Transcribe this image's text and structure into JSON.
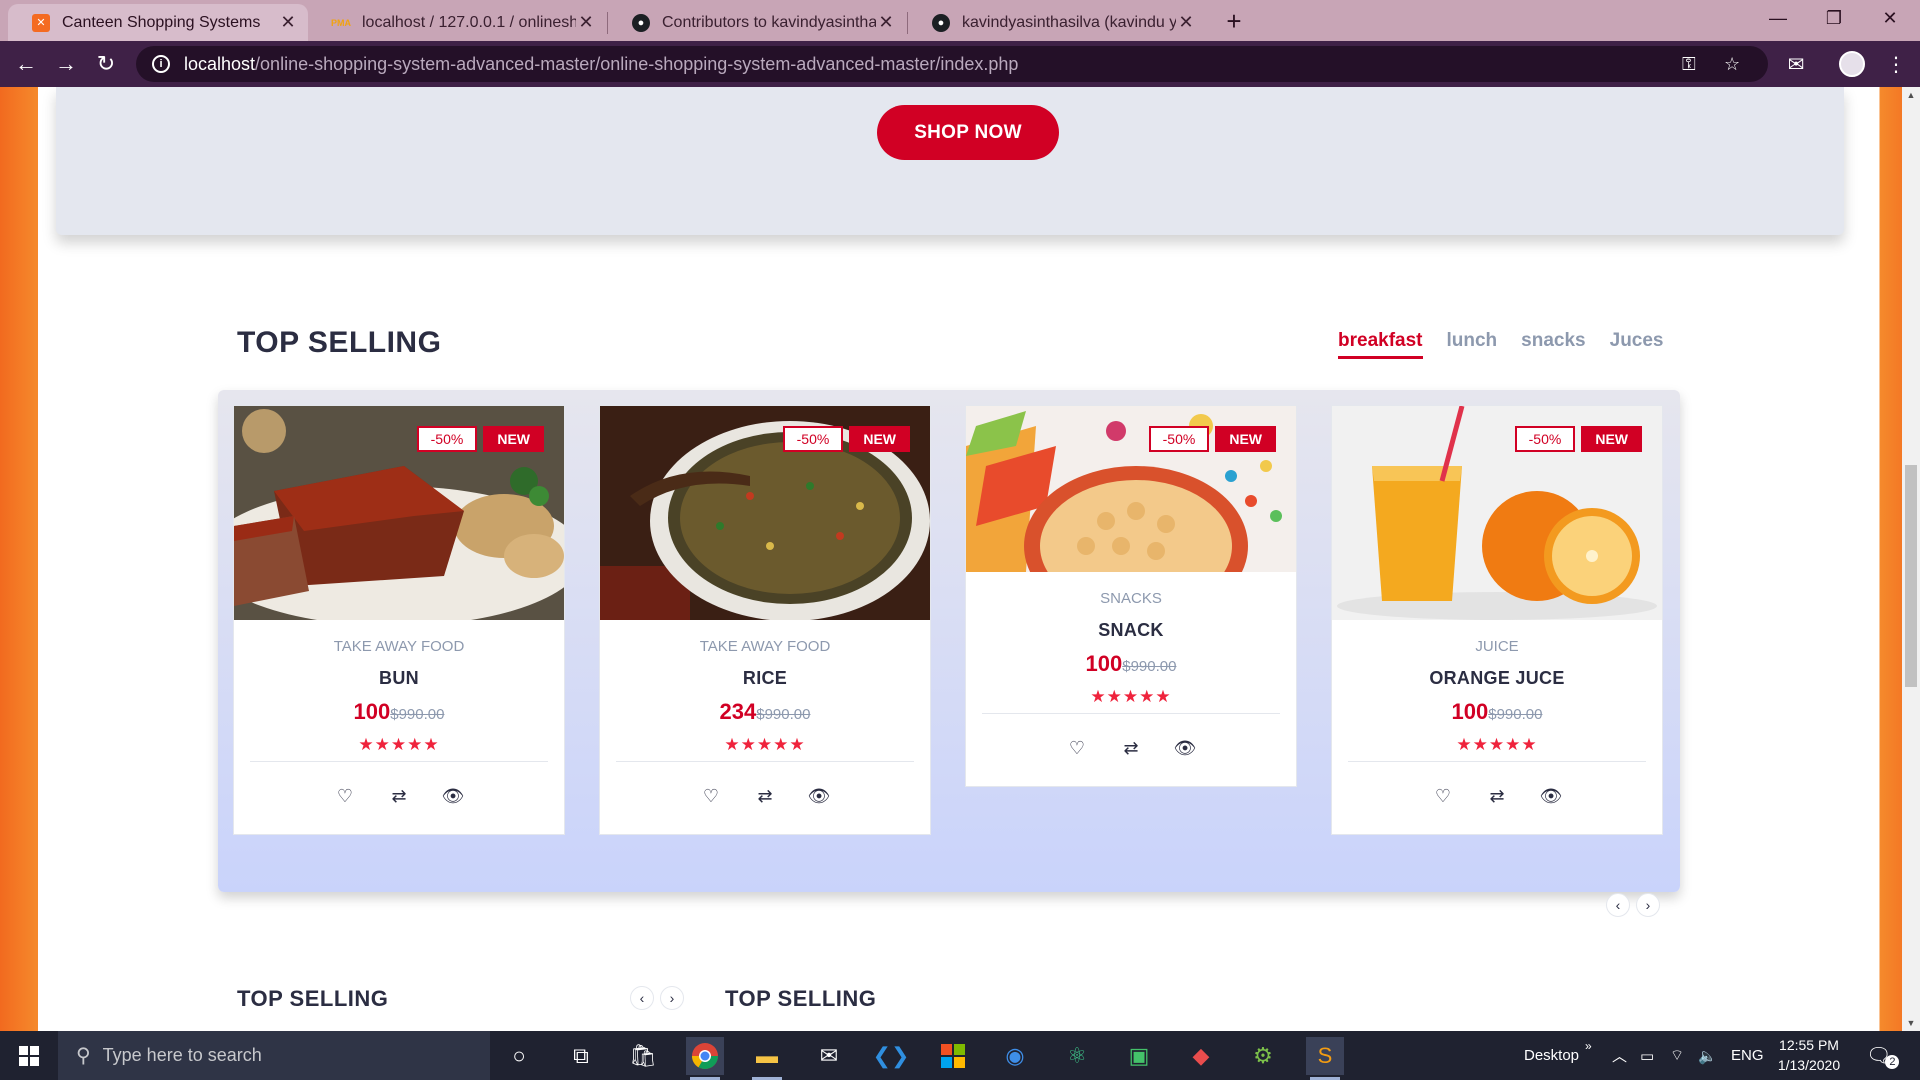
{
  "browser": {
    "tabs": [
      {
        "title": "Canteen Shopping Systems",
        "active": true
      },
      {
        "title": "localhost / 127.0.0.1 / onlineshop",
        "active": false
      },
      {
        "title": "Contributors to kavindyasinthasilva",
        "active": false
      },
      {
        "title": "kavindyasinthasilva (kavindu yasi",
        "active": false
      }
    ],
    "url_host": "localhost",
    "url_path": "/online-shopping-system-advanced-master/online-shopping-system-advanced-master/index.php"
  },
  "hero": {
    "shop_now": "SHOP NOW"
  },
  "section": {
    "title": "TOP SELLING",
    "tabs": [
      "breakfast",
      "lunch",
      "snacks",
      "Juces"
    ]
  },
  "products": [
    {
      "category": "TAKE AWAY FOOD",
      "name": "BUN",
      "price": "100",
      "old_price": "$990.00",
      "sale": "-50%",
      "new": "NEW",
      "rating": 5
    },
    {
      "category": "TAKE AWAY FOOD",
      "name": "RICE",
      "price": "234",
      "old_price": "$990.00",
      "sale": "-50%",
      "new": "NEW",
      "rating": 5
    },
    {
      "category": "SNACKS",
      "name": "SNACK",
      "price": "100",
      "old_price": "$990.00",
      "sale": "-50%",
      "new": "NEW",
      "rating": 5
    },
    {
      "category": "JUICE",
      "name": "ORANGE JUCE",
      "price": "100",
      "old_price": "$990.00",
      "sale": "-50%",
      "new": "NEW",
      "rating": 5
    }
  ],
  "bottom": {
    "title_left": "TOP SELLING",
    "title_right": "TOP SELLING"
  },
  "taskbar": {
    "search_placeholder": "Type here to search",
    "desktop_label": "Desktop",
    "lang": "ENG",
    "time": "12:55 PM",
    "date": "1/13/2020",
    "notifications": "2"
  },
  "colors": {
    "accent": "#d10024",
    "dark": "#2b2d42",
    "muted": "#8d99ae"
  }
}
